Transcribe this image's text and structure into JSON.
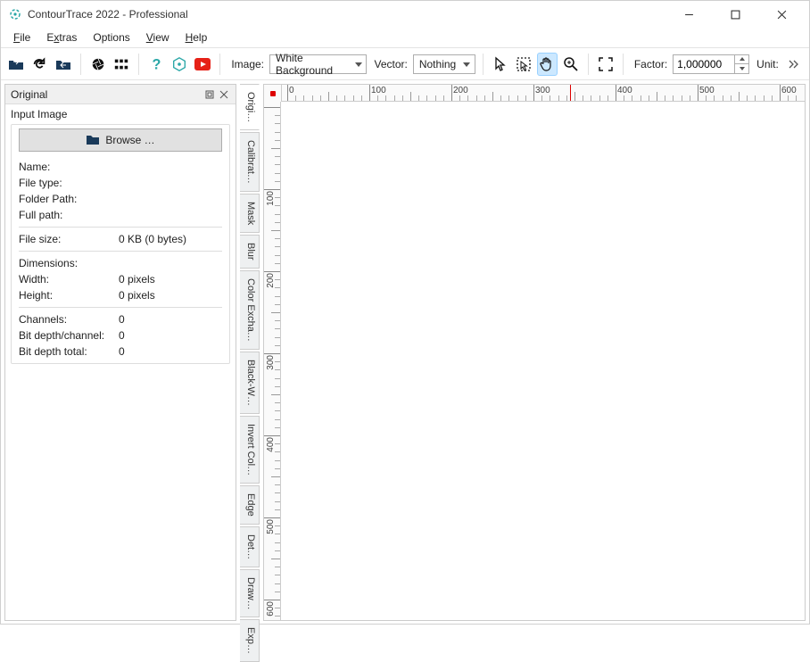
{
  "window": {
    "title": "ContourTrace 2022 - Professional"
  },
  "menubar": {
    "file": "File",
    "extras": "Extras",
    "options": "Options",
    "view": "View",
    "help": "Help"
  },
  "toolbar": {
    "image_label": "Image:",
    "image_value": "White Background",
    "vector_label": "Vector:",
    "vector_value": "Nothing",
    "factor_label": "Factor:",
    "factor_value": "1,000000",
    "unit_label": "Unit:"
  },
  "side_panel": {
    "title": "Original",
    "subtitle": "Input Image",
    "browse_label": "Browse …",
    "rows": {
      "name_k": "Name:",
      "name_v": "",
      "filetype_k": "File type:",
      "filetype_v": "",
      "folder_k": "Folder Path:",
      "folder_v": "",
      "fullpath_k": "Full path:",
      "fullpath_v": "",
      "filesize_k": "File size:",
      "filesize_v": "0 KB (0 bytes)",
      "dim_k": "Dimensions:",
      "dim_v": "",
      "width_k": "Width:",
      "width_v": "0 pixels",
      "height_k": "Height:",
      "height_v": "0 pixels",
      "channels_k": "Channels:",
      "channels_v": "0",
      "bitch_k": "Bit depth/channel:",
      "bitch_v": "0",
      "bittot_k": "Bit depth total:",
      "bittot_v": "0"
    }
  },
  "vtabs": {
    "t0": "Origi…",
    "t1": "Calibrat…",
    "t2": "Mask",
    "t3": "Blur",
    "t4": "Color Excha…",
    "t5": "Black-W…",
    "t6": "Invert Col…",
    "t7": "Edge",
    "t8": "Det…",
    "t9": "Draw…",
    "t10": "Exp…"
  },
  "ruler": {
    "h_ticks": [
      "0",
      "100",
      "200",
      "300",
      "400",
      "500",
      "600"
    ],
    "v_ticks": [
      "100",
      "200",
      "300",
      "400",
      "500",
      "600"
    ],
    "h_marker": 345
  }
}
